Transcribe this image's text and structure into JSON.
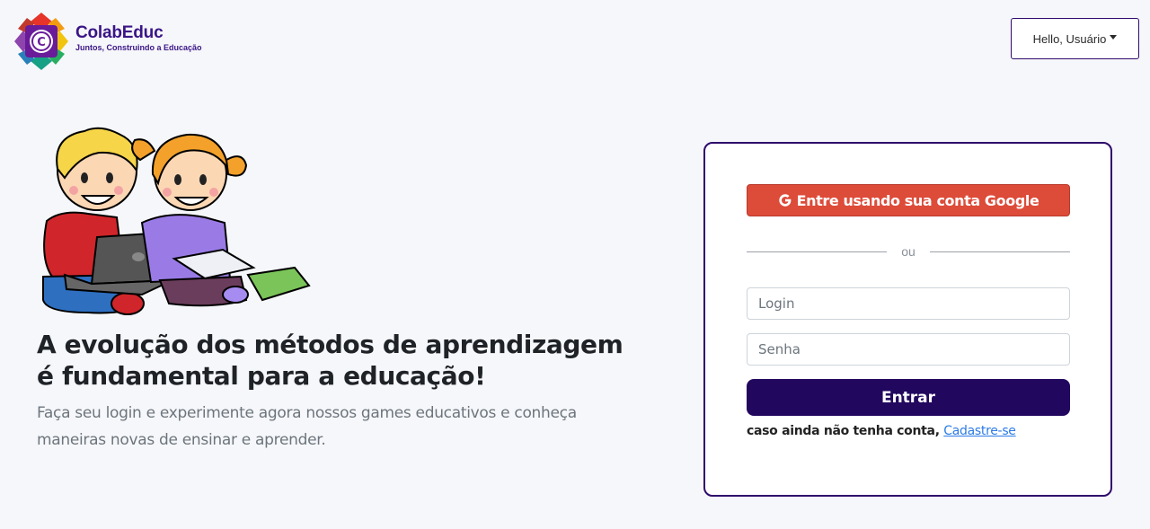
{
  "header": {
    "brand_name": "ColabEduc",
    "brand_tagline": "Juntos, Construindo a Educação",
    "user_menu_label": "Hello, Usuário"
  },
  "hero": {
    "title": "A evolução dos métodos de aprendizagem é fundamental para a educação!",
    "description": "Faça seu login e experimente agora nossos games educativos e conheça maneiras novas de ensinar e aprender."
  },
  "login_card": {
    "google_button_label": "Entre usando sua conta Google",
    "divider_text": "ou",
    "login_placeholder": "Login",
    "password_placeholder": "Senha",
    "submit_label": "Entrar",
    "signup_prompt": "caso ainda não tenha conta,",
    "signup_link": "Cadastre-se"
  },
  "icons": {
    "logo": "colabeduc-logo-icon",
    "google": "google-g-icon",
    "caret": "caret-down-icon",
    "illustration": "kids-with-laptop-illustration"
  },
  "colors": {
    "brand": "#3a1586",
    "primary": "#22075e",
    "google": "#dd4b39",
    "link": "#2c7be5"
  }
}
